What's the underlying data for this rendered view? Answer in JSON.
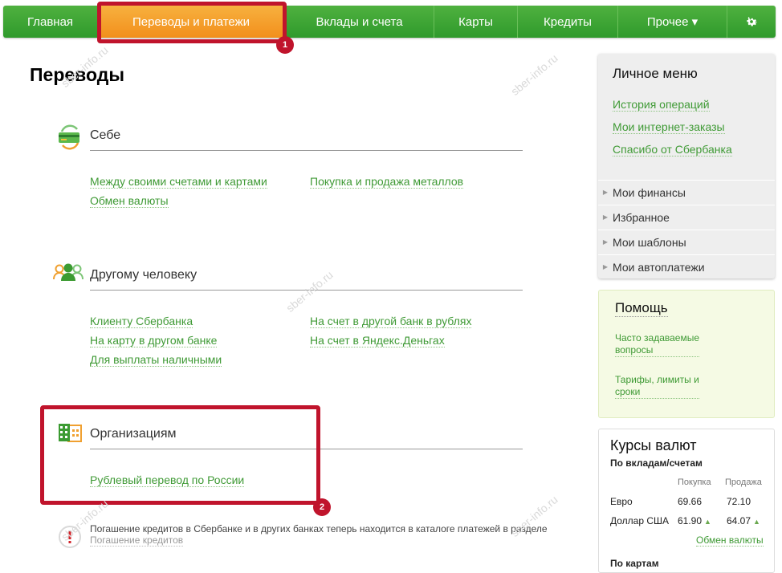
{
  "nav": {
    "items": [
      {
        "label": "Главная"
      },
      {
        "label": "Переводы и платежи",
        "active": true
      },
      {
        "label": "Вклады и счета"
      },
      {
        "label": "Карты"
      },
      {
        "label": "Кредиты"
      },
      {
        "label": "Прочее ▾"
      }
    ],
    "settings_icon": "gear-icon"
  },
  "annotations": {
    "badge1": "1",
    "badge2": "2"
  },
  "page_title": "Переводы",
  "sections": {
    "self": {
      "title": "Себе",
      "links": [
        "Между своими счетами и картами",
        "Обмен валюты",
        "Покупка и продажа металлов"
      ]
    },
    "person": {
      "title": "Другому человеку",
      "links": [
        "Клиенту Сбербанка",
        "На карту в другом банке",
        "Для выплаты наличными",
        "На счет в другой банк в рублях",
        "На счет в Яндекс.Деньгах"
      ]
    },
    "org": {
      "title": "Организациям",
      "links": [
        "Рублевый перевод по России"
      ]
    }
  },
  "notice": {
    "text": "Погашение кредитов в Сбербанке и в других банках теперь находится в каталоге платежей в разделе",
    "link": "Погашение кредитов"
  },
  "personal_menu": {
    "title": "Личное меню",
    "links": [
      "История операций",
      "Мои интернет-заказы",
      "Спасибо от Сбербанка"
    ],
    "items": [
      "Мои финансы",
      "Избранное",
      "Мои шаблоны",
      "Мои автоплатежи"
    ]
  },
  "help": {
    "title": "Помощь",
    "link1_l1": "Часто задаваемые",
    "link1_l2": "вопросы",
    "link2_l1": "Тарифы, лимиты и",
    "link2_l2": "сроки"
  },
  "rates": {
    "title": "Курсы валют",
    "subtitle": "По вкладам/счетам",
    "buy_header": "Покупка",
    "sell_header": "Продажа",
    "rows": [
      {
        "currency": "Евро",
        "buy": "69.66",
        "sell": "72.10"
      },
      {
        "currency": "Доллар США",
        "buy": "61.90",
        "sell": "64.07"
      }
    ],
    "more_link": "Обмен валюты",
    "cards_subtitle": "По картам"
  },
  "watermark": "sber-info.ru",
  "colors": {
    "nav_green": "#3aa432",
    "active_orange": "#f5a12e",
    "link_green": "#3f9a35",
    "highlight_red": "#c0142c"
  }
}
